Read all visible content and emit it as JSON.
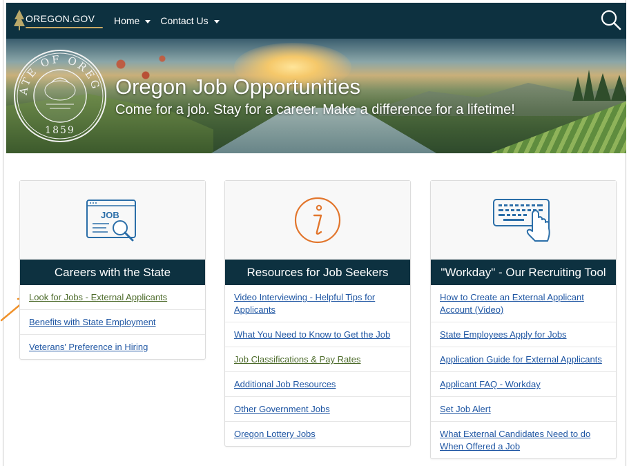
{
  "nav": {
    "logo_text": "OREGON.GOV",
    "items": [
      {
        "label": "Home"
      },
      {
        "label": "Contact Us"
      }
    ]
  },
  "hero": {
    "title": "Oregon Job Opportunities",
    "subtitle": "Come for a job. Stay for a career. Make a difference for a lifetime!",
    "seal_text_top": "STATE OF OREGON",
    "seal_year": "1859"
  },
  "cards": [
    {
      "title": "Careers with the State",
      "icon": "job-search-icon",
      "icon_label": "JOB",
      "links": [
        {
          "label": "Look for Jobs - External Applicants",
          "visited": true
        },
        {
          "label": "Benefits with State Employment",
          "visited": false
        },
        {
          "label": "Veterans' Preference in Hiring",
          "visited": false
        }
      ]
    },
    {
      "title": "Resources for Job Seekers",
      "icon": "info-icon",
      "links": [
        {
          "label": "Video Interviewing - Helpful Tips for Applicants",
          "visited": false
        },
        {
          "label": "What You Need to Know to Get the Job",
          "visited": false
        },
        {
          "label": "Job Classifications & Pay Rates",
          "visited": true
        },
        {
          "label": "Additional Job Resources",
          "visited": false
        },
        {
          "label": "Other Government Jobs",
          "visited": false
        },
        {
          "label": "Oregon Lottery Jobs",
          "visited": false
        }
      ]
    },
    {
      "title": "\"Workday\" - Our Recruiting Tool",
      "icon": "keyboard-touch-icon",
      "links": [
        {
          "label": "How to Create an External Applicant Account (Video)",
          "visited": false
        },
        {
          "label": "State Employees Apply for Jobs",
          "visited": false
        },
        {
          "label": "Application Guide for External Applicants",
          "visited": false
        },
        {
          "label": "Applicant FAQ - Workday",
          "visited": false
        },
        {
          "label": "Set Job Alert",
          "visited": false
        },
        {
          "label": "What External Candidates Need to do When Offered a Job",
          "visited": false
        }
      ]
    }
  ],
  "colors": {
    "nav_bg": "#0d3140",
    "link": "#1f56a3",
    "visited_link": "#4d6b2b",
    "icon_blue": "#2b6ea8",
    "icon_orange": "#e2762d",
    "annotation_arrow": "#f0922b"
  }
}
